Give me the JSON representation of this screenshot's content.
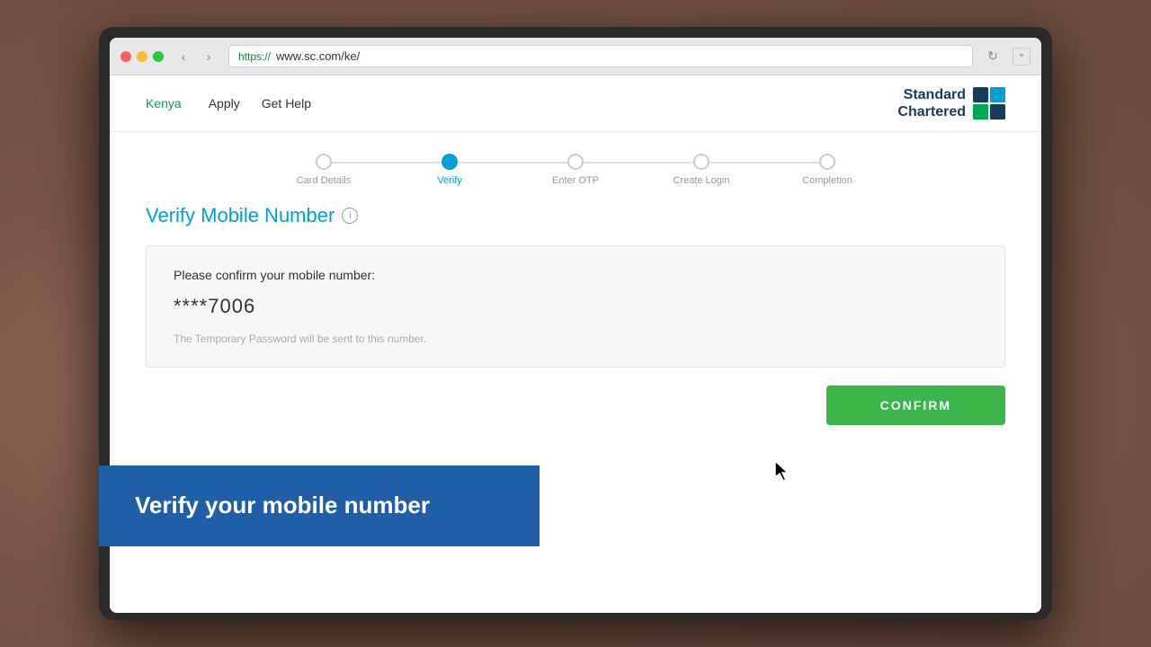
{
  "browser": {
    "url_prefix": "https://",
    "url_host": "www.sc.com/ke/",
    "reload_icon": "↻",
    "expand_icon": "+"
  },
  "nav": {
    "back_arrow": "‹",
    "forward_arrow": "›",
    "country": "Kenya",
    "links": [
      "Apply",
      "Get Help"
    ]
  },
  "brand": {
    "name_line1": "Standard",
    "name_line2": "Chartered"
  },
  "stepper": {
    "steps": [
      {
        "label": "Card Details",
        "state": "default"
      },
      {
        "label": "Verify",
        "state": "active"
      },
      {
        "label": "Enter OTP",
        "state": "default"
      },
      {
        "label": "Create Login",
        "state": "default"
      },
      {
        "label": "Completion",
        "state": "default"
      }
    ]
  },
  "page": {
    "title": "Verify Mobile Number",
    "info_icon": "i",
    "card": {
      "confirm_label": "Please confirm your mobile number:",
      "phone_masked": "****7006",
      "temp_password_note": "The Temporary Password will be sent to this number."
    },
    "confirm_button": "CONFIRM"
  },
  "overlay": {
    "text": "Verify your mobile number"
  }
}
